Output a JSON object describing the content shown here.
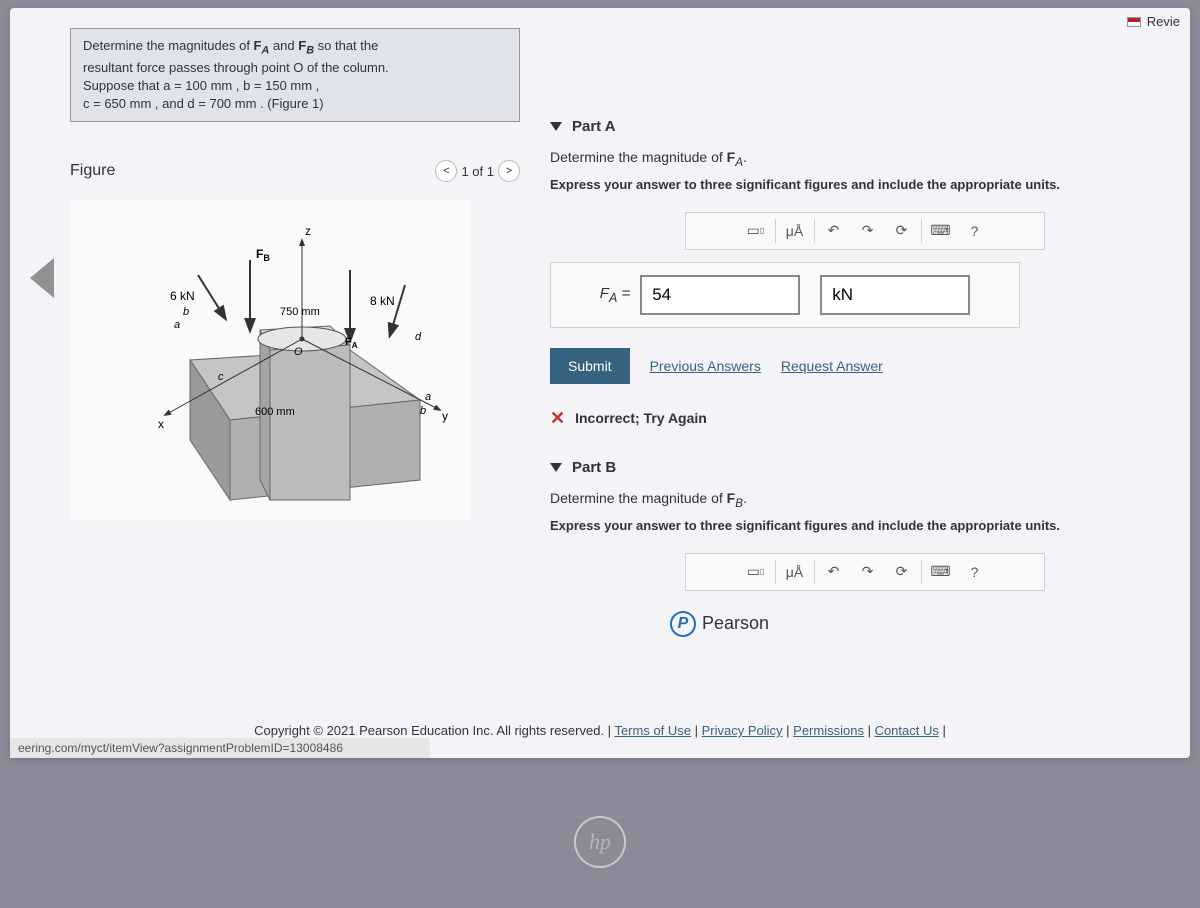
{
  "topBar": {
    "reviewLabel": "Revie"
  },
  "problem": {
    "line1_prefix": "Determine the magnitudes of ",
    "fa": "F",
    "faSub": "A",
    "and": " and ",
    "fb": "F",
    "fbSub": "B",
    "line1_suffix": " so that the",
    "line2": "resultant force passes through point O of the column.",
    "line3": "Suppose that a = 100 mm , b = 150 mm ,",
    "line4": "c = 650 mm , and d = 700 mm . (Figure 1)"
  },
  "figure": {
    "title": "Figure",
    "pageLabel": "1 of 1",
    "labels": {
      "z": "z",
      "x": "x",
      "y": "y",
      "fb": "F_B",
      "fa": "F_A",
      "sixkn": "6 kN",
      "eightkn": "8 kN",
      "b": "b",
      "a": "a",
      "c": "c",
      "d": "d",
      "dim750": "750 mm",
      "dim600": "600 mm",
      "origin": "O"
    }
  },
  "partA": {
    "label": "Part A",
    "prompt": "Determine the magnitude of F_A.",
    "instr": "Express your answer to three significant figures and include the appropriate units.",
    "answerLabel": "F_A =",
    "answerValue": "54",
    "unitValue": "kN",
    "submit": "Submit",
    "prevAns": "Previous Answers",
    "reqAns": "Request Answer",
    "feedback": "Incorrect; Try Again"
  },
  "partB": {
    "label": "Part B",
    "prompt": "Determine the magnitude of F_B.",
    "instr": "Express your answer to three significant figures and include the appropriate units."
  },
  "pearson": "Pearson",
  "footer": {
    "copyright": "Copyright © 2021 Pearson Education Inc. All rights reserved. | ",
    "terms": "Terms of Use",
    "privacy": "Privacy Policy",
    "permissions": "Permissions",
    "contact": "Contact Us"
  },
  "url": "eering.com/myct/itemView?assignmentProblemID=13008486",
  "hp": "hp",
  "tools": {
    "units": "μÅ",
    "help": "?"
  }
}
